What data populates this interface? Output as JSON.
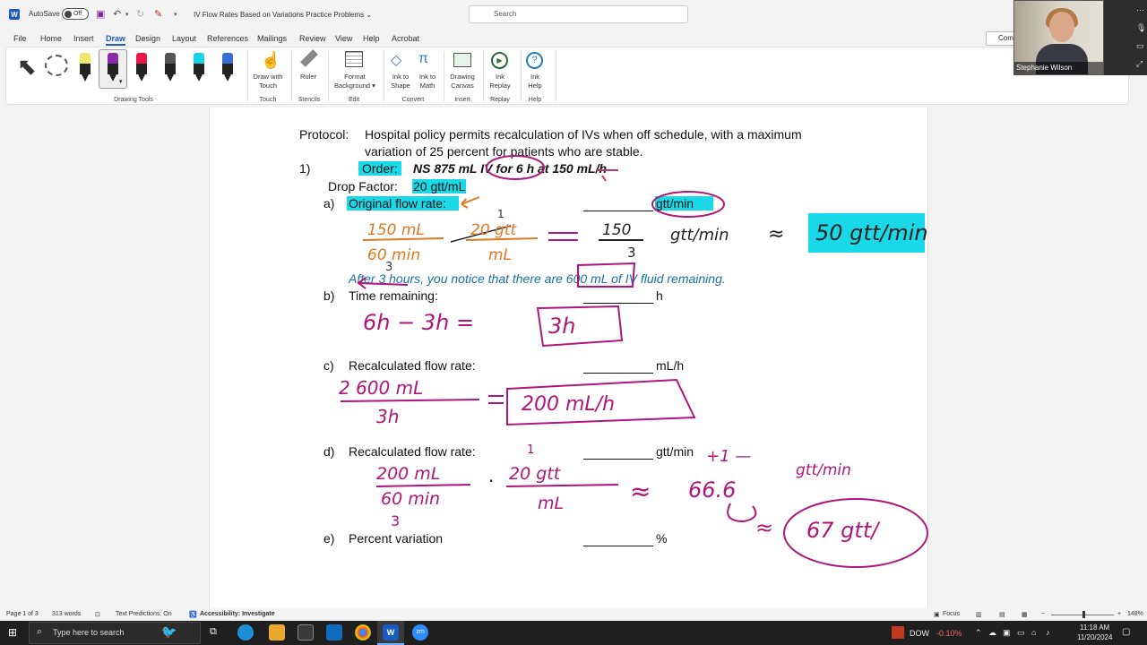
{
  "titlebar": {
    "autosave_label": "AutoSave",
    "autosave_state": "Off",
    "doc_title": "IV Flow Rates Based on Variations Practice Problems",
    "search_placeholder": "Search"
  },
  "tabs": [
    "File",
    "Home",
    "Insert",
    "Draw",
    "Design",
    "Layout",
    "References",
    "Mailings",
    "Review",
    "View",
    "Help",
    "Acrobat"
  ],
  "active_tab": "Draw",
  "comments_label": "Com",
  "ribbon": {
    "drawing_tools_label": "Drawing Tools",
    "draw_with_touch": [
      "Draw with",
      "Touch"
    ],
    "touch_label": "Touch",
    "ruler": "Ruler",
    "stencils_label": "Stencils",
    "format_background": [
      "Format",
      "Background"
    ],
    "edit_label": "Edit",
    "ink_to_shape": [
      "Ink to",
      "Shape"
    ],
    "ink_to_math": [
      "Ink to",
      "Math"
    ],
    "convert_label": "Convert",
    "drawing_canvas": [
      "Drawing",
      "Canvas"
    ],
    "insert_label": "Insert",
    "ink_replay": [
      "Ink",
      "Replay"
    ],
    "replay_label": "Replay",
    "ink_help": [
      "Ink",
      "Help"
    ],
    "help_label": "Help",
    "pen_colors": [
      "#f2e66a",
      "#8a2aa8",
      "#e8194a",
      "#555555",
      "#1ad3e3",
      "#3b6fd6"
    ]
  },
  "video": {
    "name": "Stephanie Wilson"
  },
  "doc": {
    "protocol_label": "Protocol:",
    "protocol_line1": "Hospital policy permits recalculation of IVs when off schedule, with a maximum",
    "protocol_line2": "variation of 25 percent for patients who are stable.",
    "q_num": "1)",
    "order_label": "Order:",
    "order_text": "NS 875 mL IV for 6 h at 150 mL/h",
    "drop_factor_label": "Drop Factor:",
    "drop_factor_value": "20 gtt/mL",
    "a_letter": "a)",
    "a_label": "Original flow rate:",
    "a_unit": "gtt/min",
    "note": "After 3 hours, you notice that there are 600 mL of IV fluid remaining.",
    "b_letter": "b)",
    "b_label": "Time remaining:",
    "b_unit": "h",
    "c_letter": "c)",
    "c_label": "Recalculated flow rate:",
    "c_unit": "mL/h",
    "d_letter": "d)",
    "d_label": "Recalculated flow rate:",
    "d_unit": "gtt/min",
    "e_letter": "e)",
    "e_label": "Percent variation",
    "e_unit": "%"
  },
  "handwriting": {
    "a_frac1_num": "150 mL",
    "a_frac1_den": "60 min",
    "a_frac1_den_small": "3",
    "a_frac2_num": "20 gtt",
    "a_frac2_num_small": "1",
    "a_frac2_den": "mL",
    "a_frac3_num": "150",
    "a_frac3_den": "3",
    "a_frac3_unit": "gtt/min",
    "a_result": "50 gtt/min",
    "b_work": "6h − 3h =",
    "b_result": "3h",
    "c_work_num": "2 600 mL",
    "c_work_den": "3h",
    "c_result": "200 mL/h",
    "d_num1": "200 mL",
    "d_den1": "60 min",
    "d_den1_small": "3",
    "d_num2": "20 gtt",
    "d_num2_small": "1",
    "d_den2": "mL",
    "d_approx": "66.6",
    "d_plus": "+1 —",
    "d_unit": "gtt/min",
    "d_result": "67 gtt/"
  },
  "status": {
    "page": "Page 1 of 3",
    "words": "313 words",
    "text_predictions": "Text Predictions: On",
    "accessibility": "Accessibility: Investigate",
    "focus": "Focus",
    "zoom": "148%"
  },
  "taskbar": {
    "search_placeholder": "Type here to search",
    "dow_label": "DOW",
    "dow_change": "-0.10%",
    "time": "11:18 AM",
    "date": "11/20/2024"
  }
}
